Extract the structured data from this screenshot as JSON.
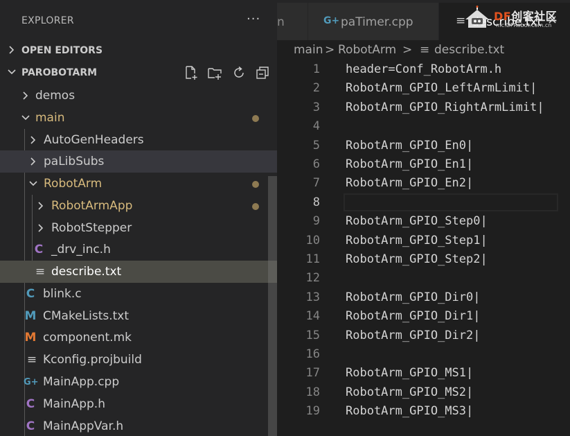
{
  "sidebar": {
    "title": "EXPLORER",
    "more": "···",
    "open_editors": "OPEN EDITORS",
    "project": "PAROBOTARM",
    "toolbar": [
      "new-file-icon",
      "new-folder-icon",
      "refresh-icon",
      "collapse-all-icon"
    ],
    "tree": {
      "demos": "demos",
      "main": "main",
      "autogenheaders": "AutoGenHeaders",
      "palibsubs": "paLibSubs",
      "robotarm": "RobotArm",
      "robotarmapp": "RobotArmApp",
      "robotstepper": "RobotStepper",
      "drv_inc": "_drv_inc.h",
      "describe": "describe.txt",
      "blink": "blink.c",
      "cmakelists": "CMakeLists.txt",
      "component": "component.mk",
      "kconfig": "Kconfig.projbuild",
      "mainapp_cpp": "MainApp.cpp",
      "mainapp_h": "MainApp.h",
      "mainappvar_h": "MainAppVar.h"
    },
    "icon_glyphs": {
      "c": "C",
      "m": "M",
      "cpp": "G+",
      "lines": "≡"
    }
  },
  "tabs": {
    "prev_partial": "n",
    "patimer": "paTimer.cpp",
    "describe": "describe.txt",
    "close": "×"
  },
  "watermark": {
    "brand_df": "DF",
    "brand_rest": "创客社区",
    "url": "mc.DFRobot.com.cn"
  },
  "breadcrumb": {
    "part1": "main",
    "sep1": ">",
    "part2": "RobotArm",
    "sep2": ">",
    "file": "describe.txt"
  },
  "editor": {
    "line_numbers": [
      "1",
      "2",
      "3",
      "4",
      "5",
      "6",
      "7",
      "8",
      "9",
      "10",
      "11",
      "12",
      "13",
      "14",
      "15",
      "16",
      "17",
      "18",
      "19"
    ],
    "lines": [
      "header=Conf_RobotArm.h",
      "RobotArm_GPIO_LeftArmLimit|",
      "RobotArm_GPIO_RightArmLimit|",
      "",
      "RobotArm_GPIO_En0|",
      "RobotArm_GPIO_En1|",
      "RobotArm_GPIO_En2|",
      "",
      "RobotArm_GPIO_Step0|",
      "RobotArm_GPIO_Step1|",
      "RobotArm_GPIO_Step2|",
      "",
      "RobotArm_GPIO_Dir0|",
      "RobotArm_GPIO_Dir1|",
      "RobotArm_GPIO_Dir2|",
      "",
      "RobotArm_GPIO_MS1|",
      "RobotArm_GPIO_MS2|",
      "RobotArm_GPIO_MS3|"
    ]
  },
  "colors": {
    "sidebar_bg": "#252526",
    "editor_bg": "#1e1e1e",
    "selected_row": "#4b4b45",
    "hover_row": "#37373d",
    "modified_folder": "#d7ba7d",
    "c_icon": "#a074c4",
    "c_icon_blue": "#519aba",
    "m_icon_orange": "#e37933",
    "cpp_icon": "#519aba"
  }
}
